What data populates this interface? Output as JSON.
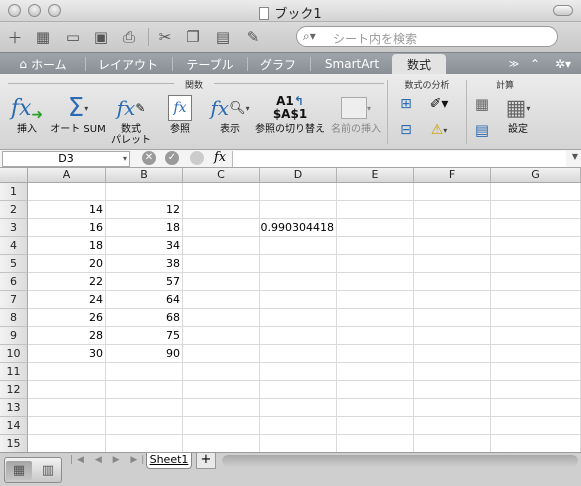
{
  "window": {
    "title": "ブック1"
  },
  "search": {
    "placeholder": "シート内を検索"
  },
  "ribbon_tabs": [
    {
      "label": "ホーム"
    },
    {
      "label": "レイアウト"
    },
    {
      "label": "テーブル"
    },
    {
      "label": "グラフ"
    },
    {
      "label": "SmartArt"
    },
    {
      "label": "数式",
      "active": true
    }
  ],
  "ribbon": {
    "groups": {
      "functions": "関数",
      "analysis": "数式の分析",
      "calc": "計算"
    },
    "buttons": {
      "insert": "挿入",
      "autosum": "オート SUM",
      "palette_1": "数式",
      "palette_2": "パレット",
      "reference": "参照",
      "show": "表示",
      "ref_toggle_top": "A1",
      "ref_toggle_mid": "$A$1",
      "ref_toggle": "参照の切り替え",
      "name_insert": "名前の挿入",
      "settings": "設定"
    }
  },
  "formula_bar": {
    "name_box": "D3",
    "fx": "fx",
    "value": ""
  },
  "grid": {
    "columns": [
      "A",
      "B",
      "C",
      "D",
      "E",
      "F",
      "G"
    ],
    "rows": [
      "1",
      "2",
      "3",
      "4",
      "5",
      "6",
      "7",
      "8",
      "9",
      "10",
      "11",
      "12",
      "13",
      "14",
      "15"
    ],
    "cells": {
      "A2": "14",
      "B2": "12",
      "A3": "16",
      "B3": "18",
      "D3": "0.990304418",
      "A4": "18",
      "B4": "34",
      "A5": "20",
      "B5": "38",
      "A6": "22",
      "B6": "57",
      "A7": "24",
      "B7": "64",
      "A8": "26",
      "B8": "68",
      "A9": "28",
      "B9": "75",
      "A10": "30",
      "B10": "90"
    }
  },
  "sheets": {
    "active": "Sheet1",
    "add": "+"
  }
}
